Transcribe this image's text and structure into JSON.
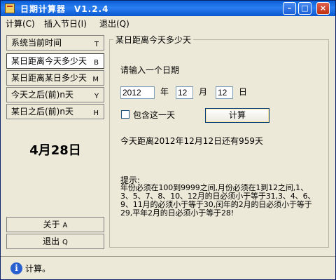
{
  "window": {
    "title": "日期计算器",
    "version": "V1.2.4",
    "controls": {
      "minimize": "–",
      "maximize": "□",
      "close": "×"
    }
  },
  "menu": [
    "计算(C)",
    "插入节日(I)",
    "退出(Q)"
  ],
  "nav": [
    {
      "label": "系统当前时间",
      "key": "T",
      "active": false
    },
    {
      "label": "某日距离今天多少天",
      "key": "B",
      "active": true
    },
    {
      "label": "某日距离某日多少天",
      "key": "M",
      "active": false
    },
    {
      "label": "今天之后(前)n天",
      "key": "Y",
      "active": false
    },
    {
      "label": "某日之后(前)n天",
      "key": "H",
      "active": false
    }
  ],
  "today_display": "4月28日",
  "bottom_buttons": [
    {
      "label": "关于",
      "key": "A"
    },
    {
      "label": "退出",
      "key": "Q"
    }
  ],
  "group": {
    "title": "某日距离今天多少天",
    "prompt": "请输入一个日期",
    "year": {
      "value": "2012",
      "unit": "年"
    },
    "month": {
      "value": "12",
      "unit": "月"
    },
    "day": {
      "value": "12",
      "unit": "日"
    },
    "include_checkbox": {
      "label": "包含这一天",
      "checked": false
    },
    "calc_button": "计算",
    "result": "今天距离2012年12月12日还有959天",
    "hint_title": "提示:",
    "hint_text": "年份必须在100到9999之间,月份必须在1到12之间,1、3、5、7、8、10、12月的日必须小于等于31,3、4、6、9、11月的必须小于等于30,闰年的2月的日必须小于等于29,平年2月的日必须小于等于28!"
  },
  "status": {
    "icon": "info-icon",
    "text": "计算。"
  }
}
